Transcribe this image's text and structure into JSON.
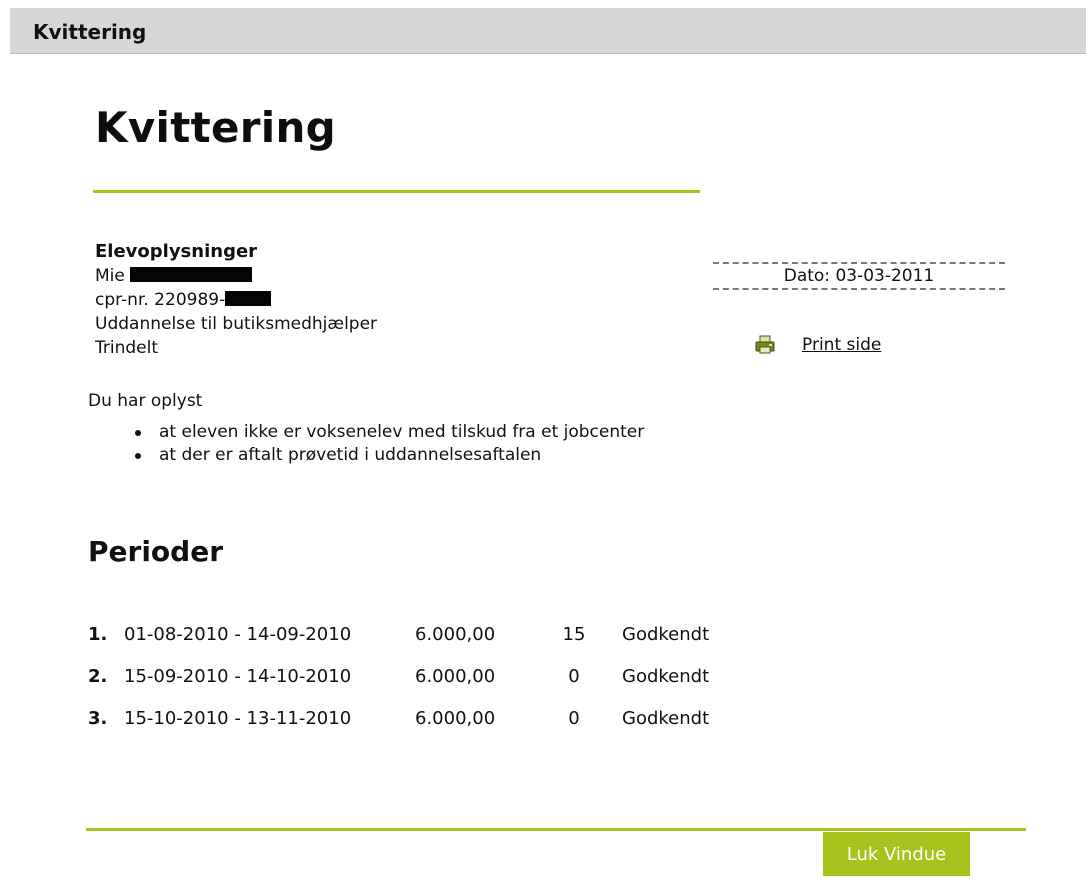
{
  "window": {
    "title": "Kvittering"
  },
  "page": {
    "heading": "Kvittering"
  },
  "student": {
    "section_title": "Elevoplysninger",
    "name_first": "Mie",
    "cpr_label": "cpr-nr. 220989-",
    "education": "Uddannelse til butiksmedhjælper",
    "step": "Trindelt"
  },
  "receipt": {
    "date": "Dato: 03-03-2011"
  },
  "print": {
    "label": "Print side",
    "icon": "printer-icon"
  },
  "declaration": {
    "intro": "Du har oplyst",
    "items": [
      "at eleven ikke er voksenelev med tilskud fra et jobcenter",
      "at der er aftalt prøvetid i uddannelsesaftalen"
    ]
  },
  "periods": {
    "title": "Perioder",
    "rows": [
      {
        "num": "1.",
        "range": "01-08-2010 - 14-09-2010",
        "amount": "6.000,00",
        "days": "15",
        "status": "Godkendt"
      },
      {
        "num": "2.",
        "range": "15-09-2010 - 14-10-2010",
        "amount": "6.000,00",
        "days": "0",
        "status": "Godkendt"
      },
      {
        "num": "3.",
        "range": "15-10-2010 - 13-11-2010",
        "amount": "6.000,00",
        "days": "0",
        "status": "Godkendt"
      }
    ]
  },
  "footer": {
    "close_label": "Luk Vindue"
  },
  "colors": {
    "accent": "#a6c21d",
    "titlebar": "#d6d6d6"
  }
}
